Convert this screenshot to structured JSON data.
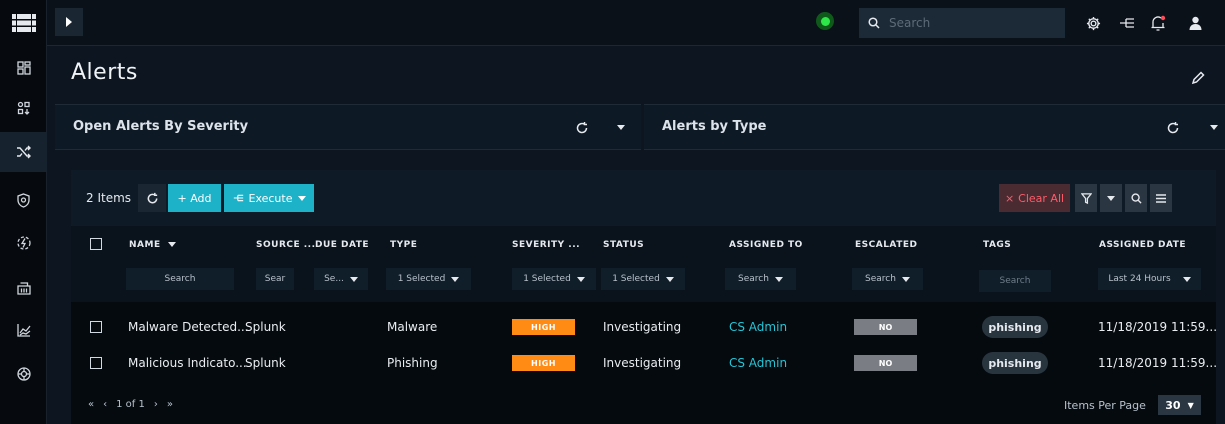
{
  "topbar": {
    "search_placeholder": "Search"
  },
  "page": {
    "title": "Alerts"
  },
  "widgets": [
    {
      "title": "Open Alerts By Severity"
    },
    {
      "title": "Alerts by Type"
    }
  ],
  "toolbar": {
    "items_count": "2 Items",
    "add_label": "+ Add",
    "execute_label": "Execute",
    "clear_all_label": "Clear All"
  },
  "columns": [
    {
      "label": "NAME",
      "filter": "Search"
    },
    {
      "label": "SOURCE ...",
      "filter": "Sear"
    },
    {
      "label": "DUE DATE",
      "filter": "Se..."
    },
    {
      "label": "TYPE",
      "filter": "1 Selected"
    },
    {
      "label": "SEVERITY ...",
      "filter": "1 Selected"
    },
    {
      "label": "STATUS",
      "filter": "1 Selected"
    },
    {
      "label": "ASSIGNED TO",
      "filter": "Search"
    },
    {
      "label": "ESCALATED",
      "filter": "Search"
    },
    {
      "label": "TAGS",
      "filter": "Search"
    },
    {
      "label": "ASSIGNED DATE",
      "filter": "Last 24 Hours"
    }
  ],
  "rows": [
    {
      "name": "Malware Detected...",
      "source": "Splunk",
      "type": "Malware",
      "severity": "HIGH",
      "status": "Investigating",
      "assigned_to": "CS Admin",
      "escalated": "NO",
      "tag": "phishing",
      "assigned_date": "11/18/2019 11:59..."
    },
    {
      "name": "Malicious Indicato...",
      "source": "Splunk",
      "type": "Phishing",
      "severity": "HIGH",
      "status": "Investigating",
      "assigned_to": "CS Admin",
      "escalated": "NO",
      "tag": "phishing",
      "assigned_date": "11/18/2019 11:59..."
    }
  ],
  "footer": {
    "page_info": "1 of 1",
    "per_page_label": "Items Per Page",
    "per_page_value": "30"
  },
  "colors": {
    "accent": "#1eb2c8",
    "severity_high": "#ff8a14",
    "link": "#27c5d6",
    "clear": "#ff5c6a"
  },
  "icons": {
    "rail": [
      "dashboard-icon",
      "queue-icon",
      "shuffle-icon",
      "shield-icon",
      "lightning-icon",
      "building-icon",
      "chart-icon",
      "globe-icon"
    ],
    "topbar": [
      "gear-icon",
      "network-icon",
      "bell-icon",
      "user-icon"
    ]
  }
}
